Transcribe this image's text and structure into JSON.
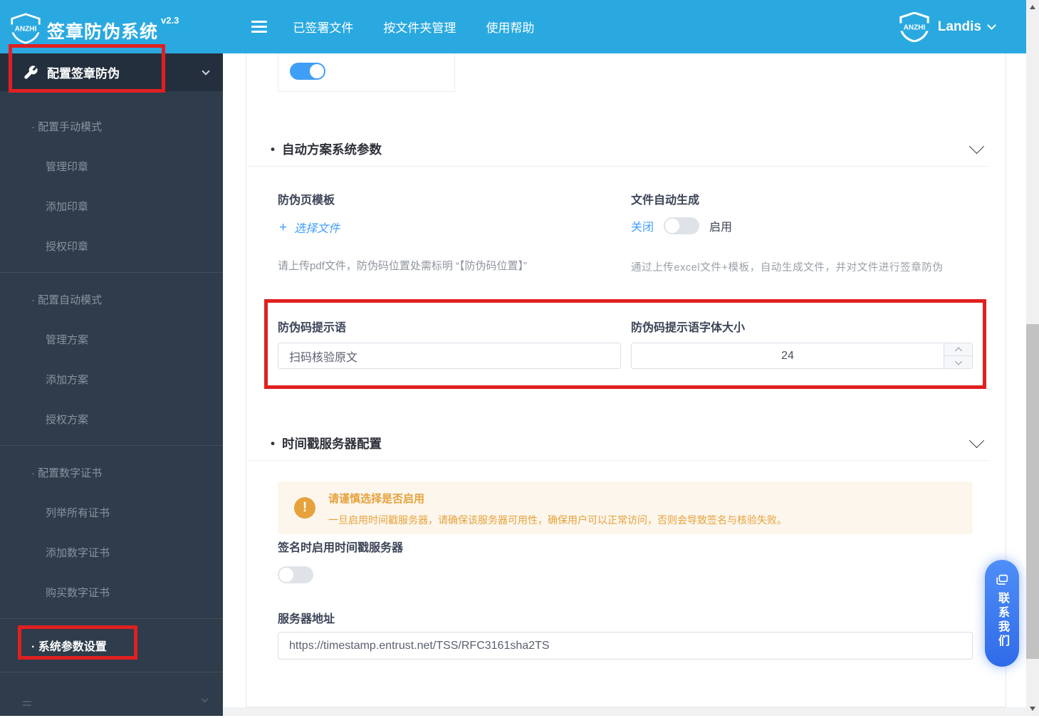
{
  "ui": {
    "bullet": "•",
    "plus": "+",
    "exclamation": "!"
  },
  "header": {
    "logo_text": "ANZHI",
    "title": "签章防伪系统",
    "version": "v2.3",
    "nav": [
      "已签署文件",
      "按文件夹管理",
      "使用帮助"
    ],
    "user_name": "Landis",
    "bar_color": "#2aa9e1"
  },
  "sidebar": {
    "main_item": "配置签章防伪",
    "groups": [
      {
        "heading": "· 配置手动模式",
        "items": [
          "管理印章",
          "添加印章",
          "授权印章"
        ],
        "active": false
      },
      {
        "heading": "· 配置自动模式",
        "items": [
          "管理方案",
          "添加方案",
          "授权方案"
        ],
        "active": false
      },
      {
        "heading": "· 配置数字证书",
        "items": [
          "列举所有证书",
          "添加数字证书",
          "购买数字证书"
        ],
        "active": false
      },
      {
        "heading": "· 系统参数设置",
        "items": [],
        "active": true
      }
    ]
  },
  "main": {
    "top_toggle_state": "on",
    "auto_section": {
      "title": "自动方案系统参数",
      "template_label": "防伪页模板",
      "choose_file": "选择文件",
      "template_hint": "请上传pdf文件，防伪码位置处需标明 “【防伪码位置】”",
      "autogen_label": "文件自动生成",
      "autogen_off": "关闭",
      "autogen_on": "启用",
      "autogen_state": "off",
      "autogen_hint": "通过上传excel文件+模板，自动生成文件，并对文件进行签章防伪",
      "prompt_label": "防伪码提示语",
      "prompt_value": "扫码核验原文",
      "font_size_label": "防伪码提示语字体大小",
      "font_size_value": "24"
    },
    "timestamp_section": {
      "title": "时间戳服务器配置",
      "alert_title": "请谨慎选择是否启用",
      "alert_body": "一旦启用时间戳服务器，请确保该服务器可用性，确保用户可以正常访问，否则会导致签名与核验失败。",
      "enable_label": "签名时启用时间戳服务器",
      "enable_state": "off",
      "server_label": "服务器地址",
      "server_value": "https://timestamp.entrust.net/TSS/RFC3161sha2TS"
    }
  },
  "contact": {
    "label": "联系我们"
  },
  "annotation_color": "#e02020"
}
